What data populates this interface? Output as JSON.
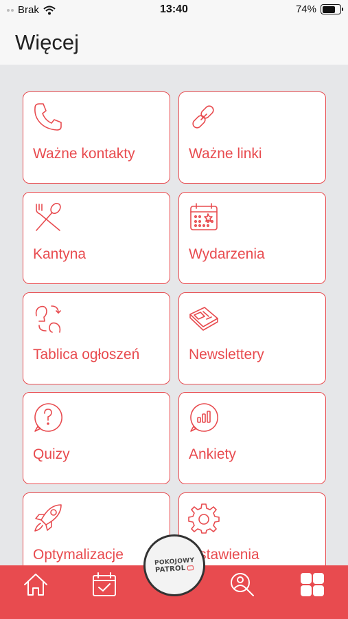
{
  "status_bar": {
    "carrier": "Brak",
    "time": "13:40",
    "battery_percent": "74%",
    "battery_level": 0.74
  },
  "header": {
    "title": "Więcej"
  },
  "tiles": [
    {
      "label": "Ważne kontakty",
      "icon": "phone-icon"
    },
    {
      "label": "Ważne linki",
      "icon": "link-icon"
    },
    {
      "label": "Kantyna",
      "icon": "fork-spoon-icon"
    },
    {
      "label": "Wydarzenia",
      "icon": "calendar-icon"
    },
    {
      "label": "Tablica ogłoszeń",
      "icon": "people-talk-icon"
    },
    {
      "label": "Newslettery",
      "icon": "newspaper-icon"
    },
    {
      "label": "Quizy",
      "icon": "question-bubble-icon"
    },
    {
      "label": "Ankiety",
      "icon": "poll-bubble-icon"
    },
    {
      "label": "Optymalizacje",
      "icon": "rocket-icon"
    },
    {
      "label": "Ustawienia",
      "icon": "gear-icon"
    }
  ],
  "center_button": {
    "line1": "POKOJOWY",
    "line2": "PATROL"
  },
  "tab_bar": {
    "accent_color": "#e84b4f",
    "tabs": [
      "home-icon",
      "calendar-check-icon",
      "user-search-icon",
      "grid-icon"
    ]
  }
}
